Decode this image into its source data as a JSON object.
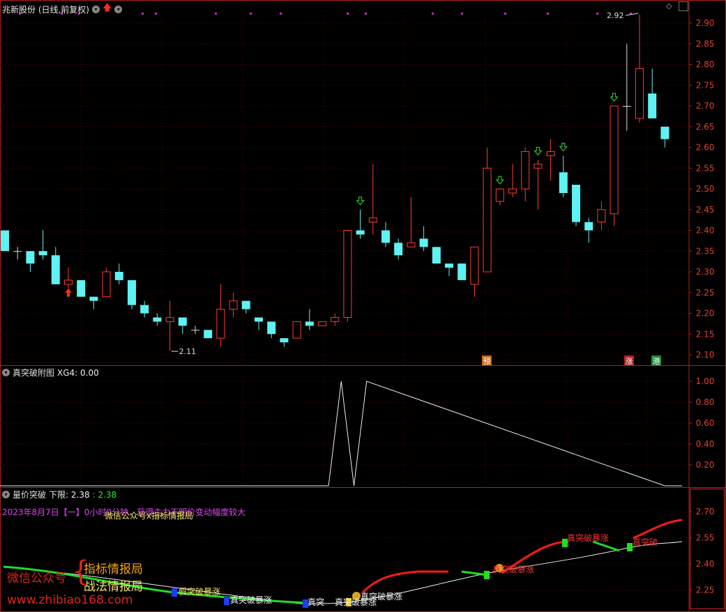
{
  "main_panel": {
    "title": "兆新股份 (日线,前复权)",
    "y_ticks": [
      "2.90",
      "2.85",
      "2.80",
      "2.75",
      "2.70",
      "2.65",
      "2.60",
      "2.55",
      "2.50",
      "2.45",
      "2.40",
      "2.35",
      "2.30",
      "2.25",
      "2.20",
      "2.15",
      "2.10"
    ],
    "high_label": "2.92",
    "low_label": "2.11",
    "badges": [
      {
        "text": "预",
        "color": "#c46a1b"
      },
      {
        "text": "涨",
        "color": "#b22222"
      },
      {
        "text": "港",
        "color": "#1e8f3a"
      }
    ]
  },
  "sub_panel1": {
    "title": "真突破附图",
    "value_label": "XG4: 0.00",
    "y_ticks": [
      "1.00",
      "0.80",
      "0.60",
      "0.40",
      "0.20"
    ]
  },
  "sub_panel2": {
    "title": "量价突破",
    "lower_label": "下限: 2.38",
    "lower_value": ": 2.38",
    "y_ticks": [
      "2.70",
      "2.55",
      "2.40",
      "2.25"
    ],
    "info_line": "2023年8月7日【一】0小时0分钟，获得主力不明价变动幅度较大",
    "overlay_line": "微信公众号x指标情报局",
    "signals": [
      "假突破暴涨",
      "真突破暴涨",
      "真突",
      "真突破暴涨",
      "真突破暴涨",
      "真突破暴涨",
      "真突破暴涨",
      "真突破"
    ]
  },
  "watermark": {
    "wechat": "微信公众号",
    "line1": "指标情报局",
    "line2": "战法情报局",
    "url": "www.zhibiao168.com"
  },
  "colors": {
    "up": "#ff3b30",
    "down": "#5ff2f2",
    "grid": "#5a0000",
    "axis": "#b0201a",
    "green": "#22dd22"
  },
  "chart_data": {
    "type": "candlestick",
    "ylim": [
      2.08,
      2.93
    ],
    "candles": [
      [
        2.4,
        2.35,
        2.4,
        2.35
      ],
      [
        2.35,
        2.35,
        2.36,
        2.33
      ],
      [
        2.35,
        2.32,
        2.35,
        2.3
      ],
      [
        2.35,
        2.34,
        2.4,
        2.33
      ],
      [
        2.34,
        2.27,
        2.36,
        2.27
      ],
      [
        2.27,
        2.28,
        2.31,
        2.26
      ],
      [
        2.28,
        2.24,
        2.28,
        2.24
      ],
      [
        2.24,
        2.23,
        2.24,
        2.21
      ],
      [
        2.24,
        2.3,
        2.31,
        2.24
      ],
      [
        2.3,
        2.28,
        2.32,
        2.27
      ],
      [
        2.28,
        2.22,
        2.28,
        2.21
      ],
      [
        2.22,
        2.2,
        2.23,
        2.19
      ],
      [
        2.19,
        2.18,
        2.2,
        2.17
      ],
      [
        2.18,
        2.19,
        2.23,
        2.11
      ],
      [
        2.19,
        2.17,
        2.19,
        2.15
      ],
      [
        2.16,
        2.16,
        2.17,
        2.15
      ],
      [
        2.16,
        2.14,
        2.16,
        2.14
      ],
      [
        2.14,
        2.21,
        2.27,
        2.12
      ],
      [
        2.21,
        2.23,
        2.25,
        2.19
      ],
      [
        2.23,
        2.21,
        2.23,
        2.2
      ],
      [
        2.19,
        2.18,
        2.19,
        2.16
      ],
      [
        2.18,
        2.15,
        2.18,
        2.14
      ],
      [
        2.14,
        2.13,
        2.14,
        2.12
      ],
      [
        2.14,
        2.18,
        2.18,
        2.14
      ],
      [
        2.18,
        2.17,
        2.21,
        2.16
      ],
      [
        2.17,
        2.18,
        2.18,
        2.17
      ],
      [
        2.18,
        2.19,
        2.2,
        2.17
      ],
      [
        2.19,
        2.4,
        2.4,
        2.18
      ],
      [
        2.4,
        2.39,
        2.45,
        2.38
      ],
      [
        2.42,
        2.43,
        2.56,
        2.39
      ],
      [
        2.4,
        2.37,
        2.42,
        2.36
      ],
      [
        2.37,
        2.34,
        2.38,
        2.33
      ],
      [
        2.36,
        2.37,
        2.48,
        2.36
      ],
      [
        2.38,
        2.36,
        2.41,
        2.35
      ],
      [
        2.36,
        2.32,
        2.36,
        2.32
      ],
      [
        2.32,
        2.31,
        2.32,
        2.29
      ],
      [
        2.32,
        2.28,
        2.32,
        2.28
      ],
      [
        2.27,
        2.36,
        2.36,
        2.24
      ],
      [
        2.3,
        2.55,
        2.6,
        2.3
      ],
      [
        2.47,
        2.5,
        2.5,
        2.46
      ],
      [
        2.49,
        2.5,
        2.56,
        2.48
      ],
      [
        2.5,
        2.59,
        2.6,
        2.47
      ],
      [
        2.55,
        2.56,
        2.57,
        2.45
      ],
      [
        2.58,
        2.59,
        2.62,
        2.52
      ],
      [
        2.54,
        2.49,
        2.58,
        2.48
      ],
      [
        2.51,
        2.42,
        2.51,
        2.41
      ],
      [
        2.42,
        2.4,
        2.43,
        2.37
      ],
      [
        2.42,
        2.45,
        2.47,
        2.4
      ],
      [
        2.44,
        2.7,
        2.7,
        2.41
      ],
      [
        2.7,
        2.7,
        2.85,
        2.64
      ],
      [
        2.67,
        2.79,
        2.92,
        2.66
      ],
      [
        2.73,
        2.67,
        2.79,
        2.67
      ],
      [
        2.65,
        2.62,
        2.65,
        2.6
      ]
    ],
    "xg4": {
      "x": [
        0,
        25.5,
        26.5,
        27.5,
        28.5,
        52
      ],
      "y": [
        0,
        0,
        1,
        0,
        1,
        0
      ]
    }
  }
}
